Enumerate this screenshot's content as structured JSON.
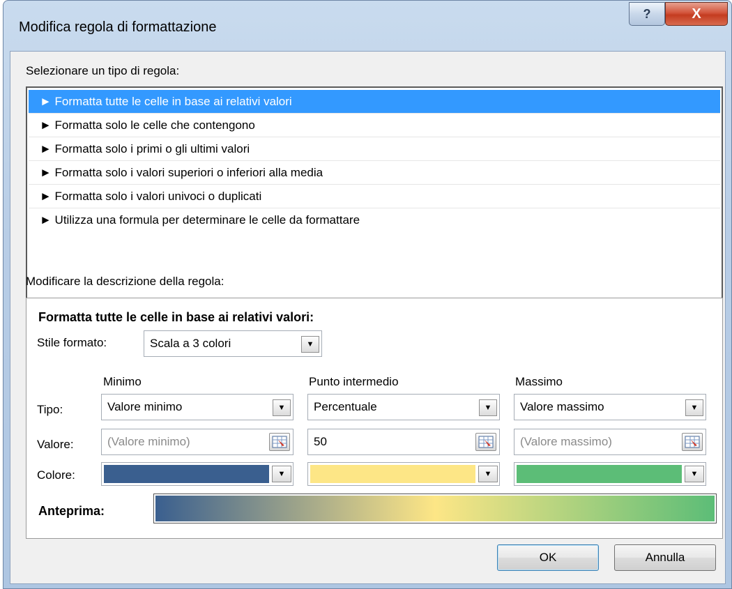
{
  "window": {
    "title": "Modifica regola di formattazione",
    "help_glyph": "?",
    "close_glyph": "X"
  },
  "rule_type": {
    "label": "Selezionare un tipo di regola:",
    "items": [
      {
        "label": "► Formatta tutte le celle in base ai relativi valori",
        "selected": true
      },
      {
        "label": "► Formatta solo le celle che contengono",
        "selected": false
      },
      {
        "label": "► Formatta solo i primi o gli ultimi valori",
        "selected": false
      },
      {
        "label": "► Formatta solo i valori superiori o inferiori alla media",
        "selected": false
      },
      {
        "label": "► Formatta solo i valori univoci o duplicati",
        "selected": false
      },
      {
        "label": "► Utilizza una formula per determinare le celle da formattare",
        "selected": false
      }
    ]
  },
  "description": {
    "label": "Modificare la descrizione della regola:",
    "heading": "Formatta tutte le celle in base ai relativi valori:",
    "style_label": "Stile formato:",
    "style_value": "Scala a 3 colori",
    "row_labels": {
      "type": "Tipo:",
      "value": "Valore:",
      "color": "Colore:"
    },
    "columns": {
      "min": {
        "header": "Minimo",
        "type": "Valore minimo",
        "value": "(Valore minimo)",
        "value_is_placeholder": true,
        "color": "#3a5f8f"
      },
      "mid": {
        "header": "Punto intermedio",
        "type": "Percentuale",
        "value": "50",
        "value_is_placeholder": false,
        "color": "#fde686"
      },
      "max": {
        "header": "Massimo",
        "type": "Valore massimo",
        "value": "(Valore massimo)",
        "value_is_placeholder": true,
        "color": "#5cbd77"
      }
    },
    "preview_label": "Anteprima:"
  },
  "buttons": {
    "ok": "OK",
    "cancel": "Annulla"
  },
  "colors": {
    "selection": "#3399ff",
    "dialog_bg": "#f0f0f0"
  }
}
